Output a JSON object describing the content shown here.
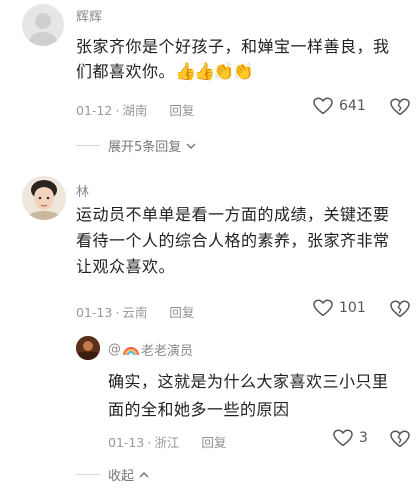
{
  "comments": [
    {
      "user": "辉辉",
      "text_line1": "张家齐你是个好孩子，和婵宝一样善良，我",
      "text_line2": "们都喜欢你。",
      "emoji": "👍👍👏👏",
      "date": "01-12",
      "location": "湖南",
      "reply_label": "回复",
      "likes": "641",
      "expand_label": "展开5条回复"
    },
    {
      "user": "林",
      "text_line1": "运动员不单单是看一方面的成绩，关键还要",
      "text_line2": "看待一个人的综合人格的素养，张家齐非常",
      "text_line3": "让观众喜欢。",
      "date": "01-13",
      "location": "云南",
      "reply_label": "回复",
      "likes": "101"
    }
  ],
  "reply": {
    "user_prefix": "@",
    "user_name": "老老演员",
    "text_line1": "确实，这就是为什么大家喜欢三小只里",
    "text_line2": "面的全和她多一些的原因",
    "date": "01-13",
    "location": "浙江",
    "reply_label": "回复",
    "likes": "3",
    "collapse_label": "收起"
  },
  "icons": {
    "like": "heart-outline-icon",
    "dislike": "broken-heart-icon",
    "expand": "chevron-down-icon",
    "collapse": "chevron-up-icon",
    "rainbow": "rainbow-icon"
  }
}
